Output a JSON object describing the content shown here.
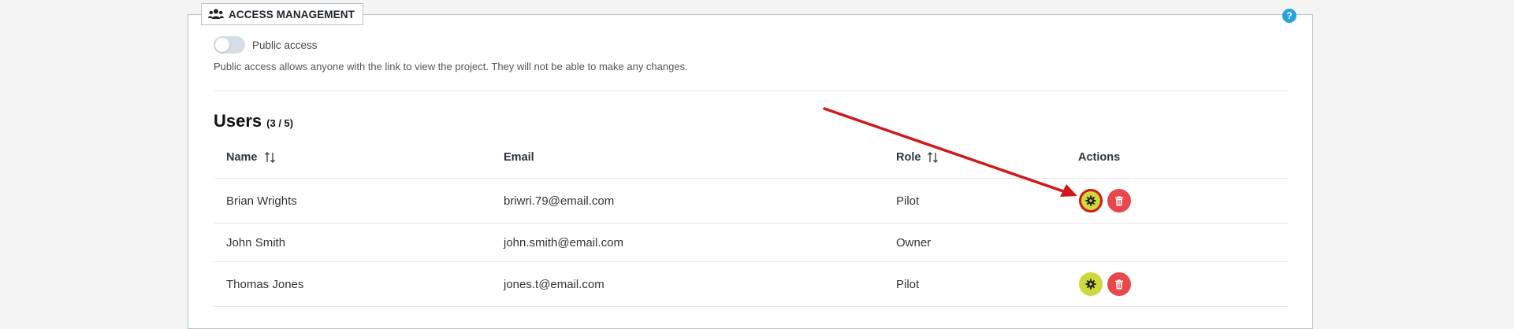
{
  "section": {
    "title": "ACCESS MANAGEMENT",
    "help_label": "?"
  },
  "public_access": {
    "label": "Public access",
    "enabled": false,
    "description": "Public access allows anyone with the link to view the project. They will not be able to make any changes."
  },
  "users": {
    "heading": "Users",
    "count": "(3 / 5)",
    "columns": {
      "name": "Name",
      "email": "Email",
      "role": "Role",
      "actions": "Actions"
    },
    "rows": [
      {
        "name": "Brian Wrights",
        "email": "briwri.79@email.com",
        "role": "Pilot",
        "actions": [
          "settings",
          "delete"
        ]
      },
      {
        "name": "John Smith",
        "email": "john.smith@email.com",
        "role": "Owner",
        "actions": []
      },
      {
        "name": "Thomas Jones",
        "email": "jones.t@email.com",
        "role": "Pilot",
        "actions": [
          "settings",
          "delete"
        ]
      }
    ]
  },
  "colors": {
    "settings_button": "#cfd83a",
    "delete_button": "#e8474b",
    "annotation_arrow": "#d01818",
    "help_icon": "#27a4dd"
  },
  "icons": {
    "section": "users-group-icon",
    "help": "question-icon",
    "sort": "sort-arrows-icon",
    "settings": "gear-icon",
    "delete": "trash-icon"
  }
}
